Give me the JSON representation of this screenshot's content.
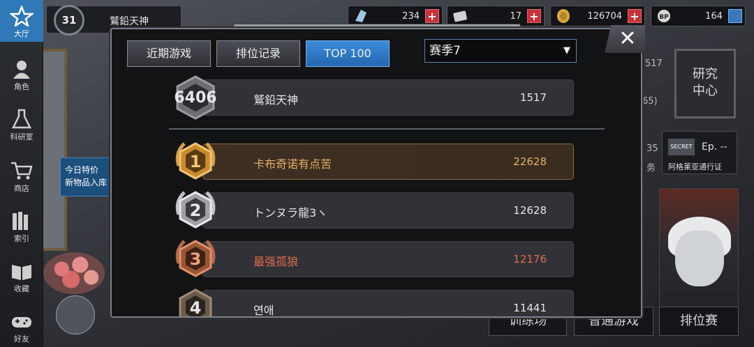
{
  "nav": {
    "items": [
      {
        "label": "大厅",
        "icon": "star-icon"
      },
      {
        "label": "角色",
        "icon": "character-icon"
      },
      {
        "label": "科研室",
        "icon": "flask-icon"
      },
      {
        "label": "商店",
        "icon": "cart-icon"
      },
      {
        "label": "索引",
        "icon": "books-icon"
      },
      {
        "label": "收藏",
        "icon": "open-book-icon"
      },
      {
        "label": "好友",
        "icon": "gamepad-icon"
      }
    ]
  },
  "player": {
    "level": "31",
    "name": "鷲鉛天神"
  },
  "currencies": [
    {
      "icon": "crystal-icon",
      "value": "234"
    },
    {
      "icon": "card-icon",
      "value": "17"
    },
    {
      "icon": "coin-icon",
      "value": "126704"
    },
    {
      "icon": "bp-icon",
      "value": "164"
    }
  ],
  "background": {
    "promo_lines": [
      "今日特价",
      "新物品入库"
    ],
    "research_label": [
      "研究",
      "中心"
    ],
    "secret_tag": "SECRET",
    "secret_ep": "Ep. --",
    "secret_sub": "阿格莱亚通行证",
    "partial_1517": "517",
    "partial_565": "65)",
    "partial_35": "35",
    "partial_wu": "务",
    "bottom_buttons": [
      "训练场",
      "普通游戏",
      "排位赛"
    ]
  },
  "modal": {
    "tabs": [
      {
        "label": "近期游戏",
        "active": false
      },
      {
        "label": "排位记录",
        "active": false
      },
      {
        "label": "TOP 100",
        "active": true
      }
    ],
    "season_selected": "赛季7",
    "close_symbol": "✕",
    "self": {
      "rank": "6406",
      "name": "鷲鉛天神",
      "score": "1517"
    },
    "rows": [
      {
        "rank": "1",
        "name": "卡布奇诺有点苦",
        "score": "22628",
        "tier": "gold"
      },
      {
        "rank": "2",
        "name": "トンヌラ龍3ヽ",
        "score": "12628",
        "tier": "silver"
      },
      {
        "rank": "3",
        "name": "最强孤狼",
        "score": "12176",
        "tier": "bronze"
      },
      {
        "rank": "4",
        "name": "연애",
        "score": "11441",
        "tier": "plain"
      }
    ]
  },
  "colors": {
    "accent_blue": "#2f79b8",
    "gold": "#e4b064",
    "silver": "#c9cdd3",
    "bronze": "#e26a4c",
    "plus_red": "#c9323a"
  }
}
